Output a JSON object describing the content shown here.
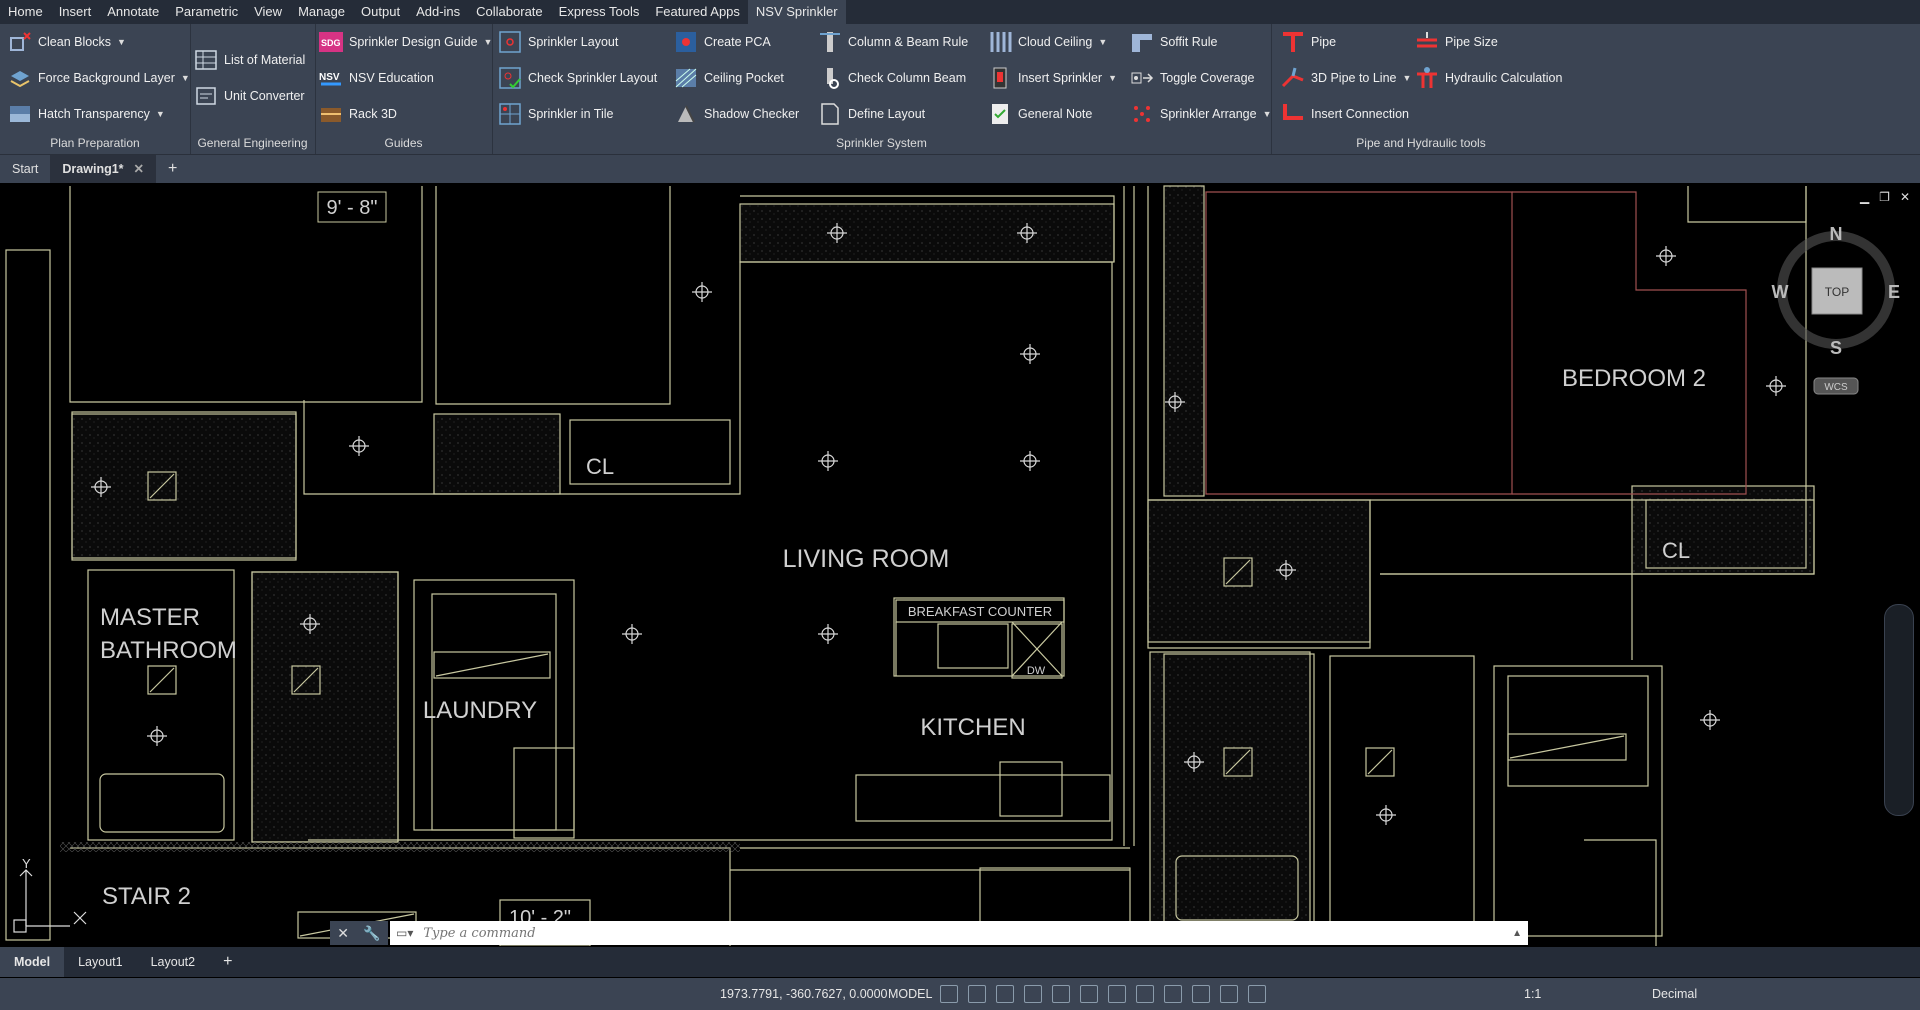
{
  "menu": [
    "Home",
    "Insert",
    "Annotate",
    "Parametric",
    "View",
    "Manage",
    "Output",
    "Add-ins",
    "Collaborate",
    "Express Tools",
    "Featured Apps",
    "NSV Sprinkler"
  ],
  "active_menu": "NSV Sprinkler",
  "ribbon": {
    "plan_preparation": {
      "title": "Plan Preparation",
      "items": [
        "Clean Blocks",
        "Force Background Layer",
        "Hatch Transparency"
      ]
    },
    "general_engineering": {
      "title": "General Engineering",
      "items": [
        "List of Material",
        "Unit Converter"
      ]
    },
    "guides": {
      "title": "Guides",
      "items": [
        "Sprinkler Design Guide",
        "NSV Education",
        "Rack 3D"
      ]
    },
    "sprinkler_system": {
      "title": "Sprinkler System",
      "items": [
        "Sprinkler Layout",
        "Check Sprinkler Layout",
        "Sprinkler in Tile",
        "Create PCA",
        "Ceiling Pocket",
        "Shadow Checker",
        "Column & Beam Rule",
        "Check Column  Beam",
        "Define Layout",
        "Cloud Ceiling",
        "Insert Sprinkler",
        "General Note",
        "Soffit Rule",
        "Toggle Coverage",
        "Sprinkler Arrange"
      ]
    },
    "pipe_hydraulic": {
      "title": "Pipe and Hydraulic tools",
      "items": [
        "Pipe",
        "3D Pipe to Line",
        "Insert Connection",
        "Pipe Size",
        "Hydraulic Calculation"
      ]
    }
  },
  "doc_tabs": {
    "start": "Start",
    "drawing": "Drawing1*",
    "add": "+"
  },
  "drawing": {
    "labels": {
      "dim1": "9' - 8\"",
      "dim2": "10' - 2\"",
      "living": "LIVING ROOM",
      "master1": "MASTER",
      "master2": "BATHROOM",
      "laundry": "LAUNDRY",
      "kitchen": "KITCHEN",
      "breakfast": "BREAKFAST COUNTER",
      "cl1": "CL",
      "cl2": "CL",
      "bedroom2": "BEDROOM 2",
      "stair2": "STAIR 2",
      "dw": "DW"
    },
    "viewcube": {
      "n": "N",
      "s": "S",
      "e": "E",
      "w": "W",
      "top": "TOP",
      "wcs": "WCS"
    },
    "ucs": {
      "y": "Y"
    }
  },
  "command": {
    "placeholder": "Type a command"
  },
  "layout_tabs": [
    "Model",
    "Layout1",
    "Layout2"
  ],
  "layout_add": "+",
  "status": {
    "coords": "1973.7791, -360.7627, 0.0000",
    "model": "MODEL",
    "scale": "1:1",
    "units": "Decimal"
  }
}
